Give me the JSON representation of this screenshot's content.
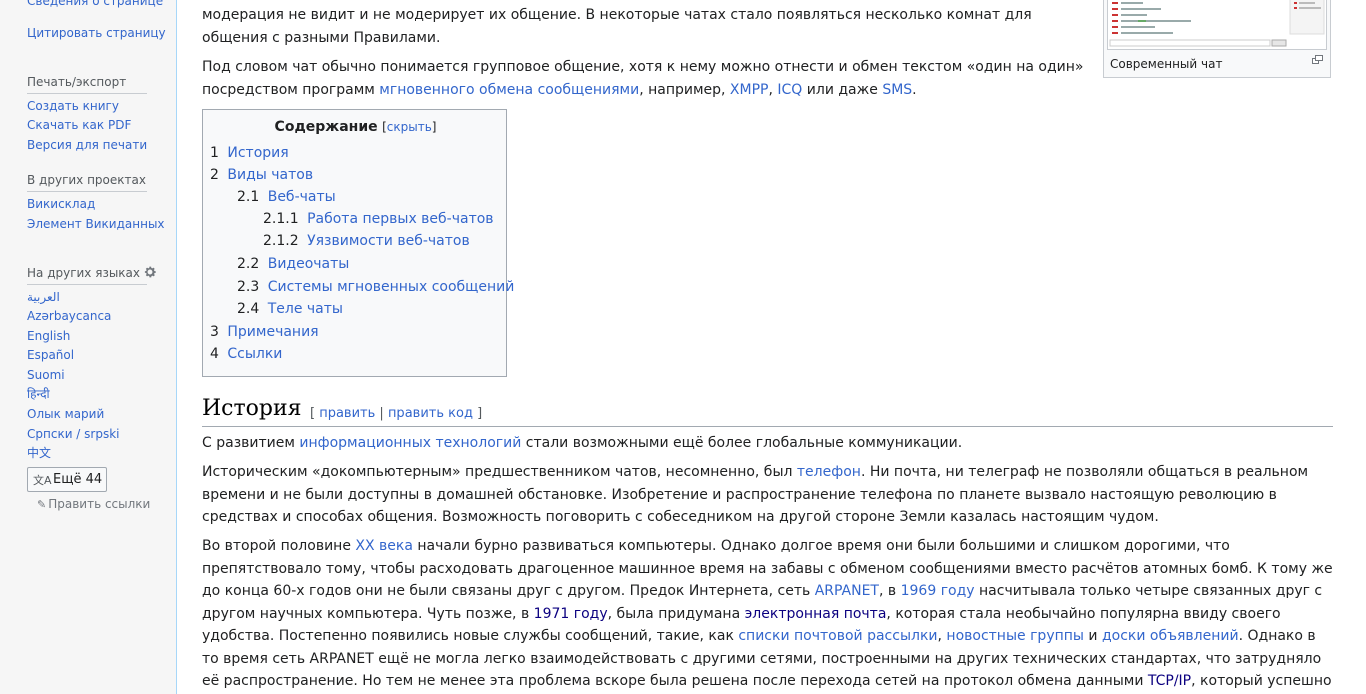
{
  "sidebar": {
    "top_links": [
      "Сведения о странице",
      "Цитировать страницу"
    ],
    "print_head": "Печать/экспорт",
    "print_links": [
      "Создать книгу",
      "Скачать как PDF",
      "Версия для печати"
    ],
    "projects_head": "В других проектах",
    "projects_links": [
      "Викисклад",
      "Элемент Викиданных"
    ],
    "languages_head": "На других языках",
    "languages": [
      "العربية",
      "Azərbaycanca",
      "English",
      "Español",
      "Suomi",
      "हिन्दी",
      "Олык марий",
      "Српски / srpski",
      "中文"
    ],
    "more_button": "Ещё 44",
    "edit_links": "Править ссылки"
  },
  "content": {
    "intro_line1": "модерация не видит и не модерирует их общение. В некоторые чатах стало появляться несколько комнат для",
    "intro_line2": "общения с разными Правилами.",
    "para2": {
      "t1": "Под словом чат обычно понимается групповое общение, хотя к нему можно отнести и обмен текстом «один на один»",
      "t2": "посредством программ ",
      "l1": "мгновенного обмена сообщениями",
      "t3": ", например, ",
      "l2": "XMPP",
      "t4": ", ",
      "l3": "ICQ",
      "t5": " или даже ",
      "l4": "SMS",
      "t6": "."
    },
    "thumb_caption": "Современный чат",
    "toc": {
      "title": "Содержание",
      "toggle": "скрыть",
      "items": [
        {
          "num": "1",
          "label": "История"
        },
        {
          "num": "2",
          "label": "Виды чатов"
        },
        {
          "num": "2.1",
          "label": "Веб-чаты"
        },
        {
          "num": "2.1.1",
          "label": "Работа первых веб-чатов"
        },
        {
          "num": "2.1.2",
          "label": "Уязвимости веб-чатов"
        },
        {
          "num": "2.2",
          "label": "Видеочаты"
        },
        {
          "num": "2.3",
          "label": "Системы мгновенных сообщений"
        },
        {
          "num": "2.4",
          "label": "Теле чаты"
        },
        {
          "num": "3",
          "label": "Примечания"
        },
        {
          "num": "4",
          "label": "Ссылки"
        }
      ]
    },
    "heading": {
      "title": "История",
      "edit": "править",
      "edit_code": "править код"
    },
    "p_hist1": {
      "t1": "С развитием ",
      "l1": "информационных технологий",
      "t2": " стали возможными ещё более глобальные коммуникации."
    },
    "p_hist2": {
      "t1": "Историческим «докомпьютерным» предшественником чатов, несомненно, был ",
      "l1": "телефон",
      "t2": ". Ни почта, ни телеграф не позволяли общаться в реальном",
      "line2": "времени и не были доступны в домашней обстановке. Изобретение и распространение телефона по планете вызвало настоящую революцию в",
      "line3": "средствах и способах общения. Возможность поговорить с собеседником на другой стороне Земли казалась настоящим чудом."
    },
    "p_hist3": {
      "a1": "Во второй половине ",
      "a_l": "XX века",
      "a2": " начали бурно развиваться компьютеры. Однако долгое время они были большими и слишком дорогими, что",
      "b": "препятствовало тому, чтобы расходовать драгоценное машинное время на забавы с обменом сообщениями вместо расчётов атомных бомб. К тому же",
      "c1": "до конца 60-х годов они не были связаны друг с другом. Предок Интернета, сеть ",
      "c_l1": "ARPANET",
      "c2": ", в ",
      "c_l2": "1969 году",
      "c3": " насчитывала только четыре связанных друг с",
      "d1": "другом научных компьютера. Чуть позже, в ",
      "d_l1": "1971 году",
      "d2": ", была придумана ",
      "d_l2": "электронная почта",
      "d3": ", которая стала необычайно популярна ввиду своего",
      "e1": "удобства. Постепенно появились новые службы сообщений, такие, как ",
      "e_l1": "списки почтовой рассылки",
      "e2": ", ",
      "e_l2": "новостные группы",
      "e3": " и ",
      "e_l3": "доски объявлений",
      "e4": ". Однако в",
      "f": "то время сеть ARPANET ещё не могла легко взаимодействовать с другими сетями, построенными на других технических стандартах, что затрудняло",
      "g1": "её распространение. Но тем не менее эта проблема вскоре была решена после перехода сетей на протокол обмена данными ",
      "g_l1": "TCP/IP",
      "g2": ", который успешно"
    }
  }
}
